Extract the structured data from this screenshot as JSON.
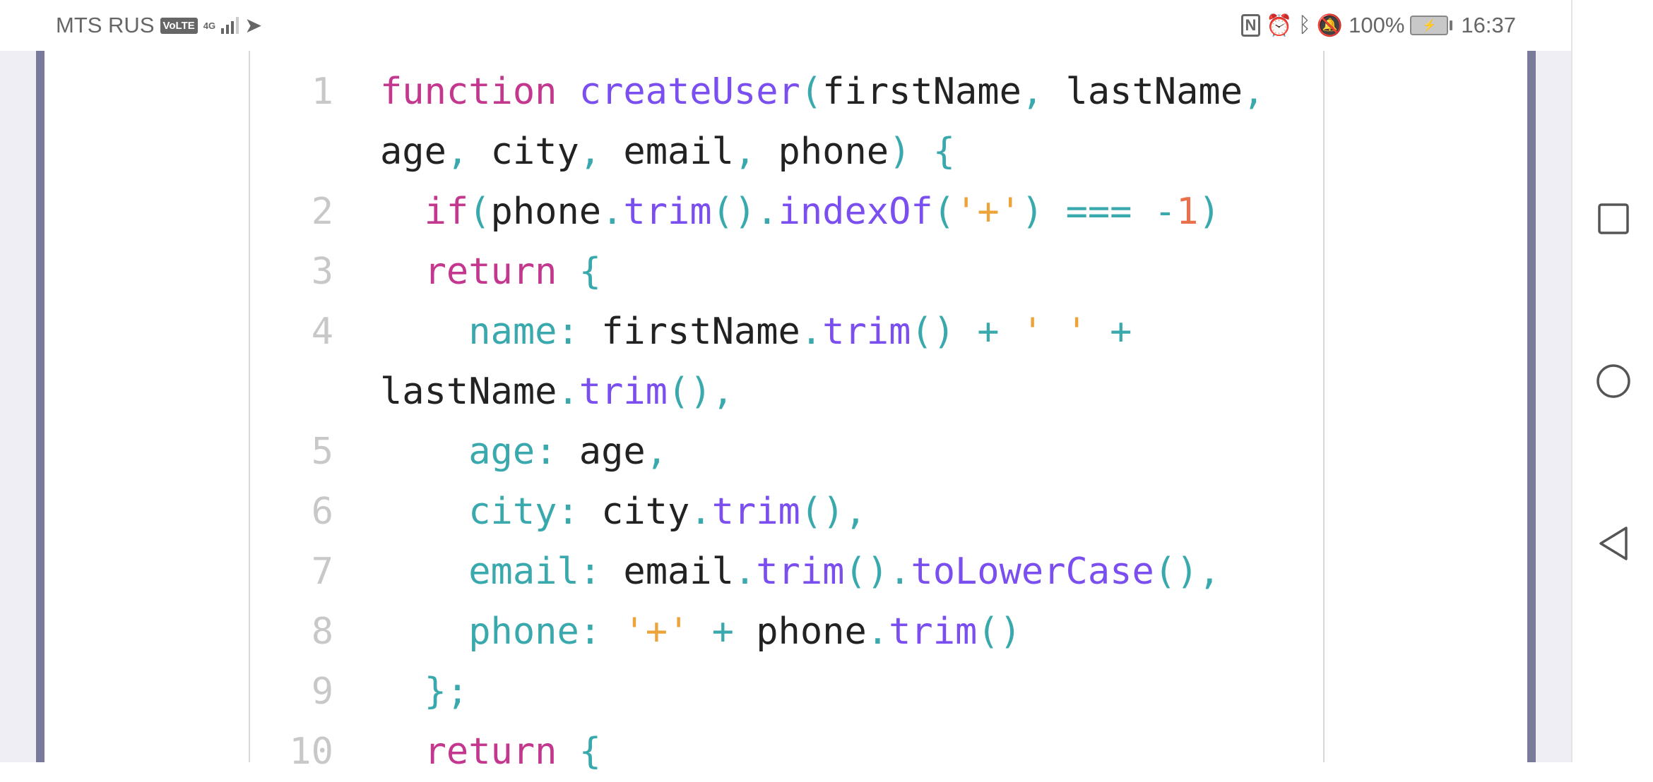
{
  "status_bar": {
    "carrier": "MTS RUS",
    "volte": "VoLTE",
    "network": "4G",
    "battery": "100%",
    "time": "16:37",
    "icons": [
      "volte-icon",
      "signal-icon",
      "telegram-icon",
      "nfc-icon",
      "alarm-icon",
      "bluetooth-icon",
      "mute-icon",
      "battery-charging-icon"
    ]
  },
  "colors": {
    "keyword": "#c4378f",
    "function": "#7b4fef",
    "punctuation": "#3aa9ad",
    "string": "#eba33a",
    "number": "#e8704a",
    "text": "#222222",
    "line_number": "#c8c8c8",
    "accent_bar": "#7a7b9b"
  },
  "code": {
    "rows": [
      {
        "num": "1",
        "tokens": [
          {
            "t": "function",
            "c": "k"
          },
          {
            "t": " ",
            "c": "v"
          },
          {
            "t": "createUser",
            "c": "f"
          },
          {
            "t": "(",
            "c": "p"
          },
          {
            "t": "firstName",
            "c": "v"
          },
          {
            "t": ",",
            "c": "p"
          },
          {
            "t": " lastName",
            "c": "v"
          },
          {
            "t": ",",
            "c": "p"
          }
        ]
      },
      {
        "num": "",
        "tokens": [
          {
            "t": "age",
            "c": "v"
          },
          {
            "t": ",",
            "c": "p"
          },
          {
            "t": " city",
            "c": "v"
          },
          {
            "t": ",",
            "c": "p"
          },
          {
            "t": " email",
            "c": "v"
          },
          {
            "t": ",",
            "c": "p"
          },
          {
            "t": " phone",
            "c": "v"
          },
          {
            "t": ")",
            "c": "p"
          },
          {
            "t": " {",
            "c": "p"
          }
        ]
      },
      {
        "num": "2",
        "tokens": [
          {
            "t": "  if",
            "c": "k"
          },
          {
            "t": "(",
            "c": "p"
          },
          {
            "t": "phone",
            "c": "v"
          },
          {
            "t": ".",
            "c": "p"
          },
          {
            "t": "trim",
            "c": "f"
          },
          {
            "t": "().",
            "c": "p"
          },
          {
            "t": "indexOf",
            "c": "f"
          },
          {
            "t": "(",
            "c": "p"
          },
          {
            "t": "'+'",
            "c": "s"
          },
          {
            "t": ") === -",
            "c": "p"
          },
          {
            "t": "1",
            "c": "n"
          },
          {
            "t": ")",
            "c": "p"
          }
        ]
      },
      {
        "num": "3",
        "tokens": [
          {
            "t": "  return",
            "c": "k"
          },
          {
            "t": " {",
            "c": "p"
          }
        ]
      },
      {
        "num": "4",
        "tokens": [
          {
            "t": "    name:",
            "c": "p"
          },
          {
            "t": " firstName",
            "c": "v"
          },
          {
            "t": ".",
            "c": "p"
          },
          {
            "t": "trim",
            "c": "f"
          },
          {
            "t": "() + ",
            "c": "p"
          },
          {
            "t": "' '",
            "c": "s"
          },
          {
            "t": " +",
            "c": "p"
          }
        ]
      },
      {
        "num": "",
        "tokens": [
          {
            "t": "lastName",
            "c": "v"
          },
          {
            "t": ".",
            "c": "p"
          },
          {
            "t": "trim",
            "c": "f"
          },
          {
            "t": "(),",
            "c": "p"
          }
        ]
      },
      {
        "num": "5",
        "tokens": [
          {
            "t": "    age:",
            "c": "p"
          },
          {
            "t": " age",
            "c": "v"
          },
          {
            "t": ",",
            "c": "p"
          }
        ]
      },
      {
        "num": "6",
        "tokens": [
          {
            "t": "    city:",
            "c": "p"
          },
          {
            "t": " city",
            "c": "v"
          },
          {
            "t": ".",
            "c": "p"
          },
          {
            "t": "trim",
            "c": "f"
          },
          {
            "t": "(),",
            "c": "p"
          }
        ]
      },
      {
        "num": "7",
        "tokens": [
          {
            "t": "    email:",
            "c": "p"
          },
          {
            "t": " email",
            "c": "v"
          },
          {
            "t": ".",
            "c": "p"
          },
          {
            "t": "trim",
            "c": "f"
          },
          {
            "t": "().",
            "c": "p"
          },
          {
            "t": "toLowerCase",
            "c": "f"
          },
          {
            "t": "(),",
            "c": "p"
          }
        ]
      },
      {
        "num": "8",
        "tokens": [
          {
            "t": "    phone:",
            "c": "p"
          },
          {
            "t": " ",
            "c": "v"
          },
          {
            "t": "'+'",
            "c": "s"
          },
          {
            "t": " + ",
            "c": "p"
          },
          {
            "t": "phone",
            "c": "v"
          },
          {
            "t": ".",
            "c": "p"
          },
          {
            "t": "trim",
            "c": "f"
          },
          {
            "t": "()",
            "c": "p"
          }
        ]
      },
      {
        "num": "9",
        "tokens": [
          {
            "t": "  };",
            "c": "p"
          }
        ]
      },
      {
        "num": "10",
        "tokens": [
          {
            "t": "  return",
            "c": "k"
          },
          {
            "t": " {",
            "c": "p"
          }
        ]
      }
    ]
  }
}
